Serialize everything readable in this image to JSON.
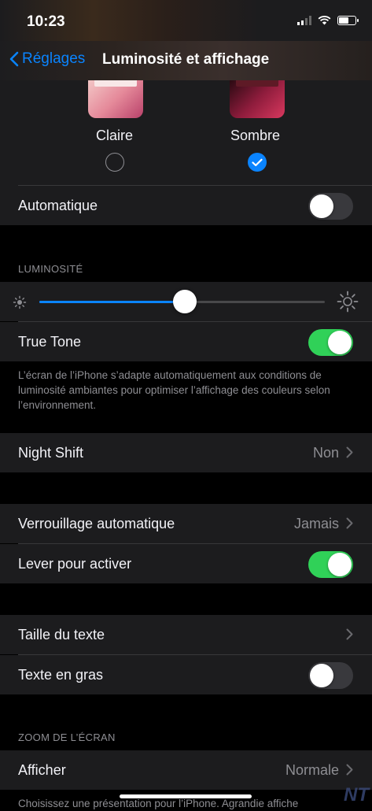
{
  "status_bar": {
    "time": "10:23"
  },
  "nav": {
    "back_label": "Réglages",
    "title": "Luminosité et affichage"
  },
  "appearance": {
    "light_label": "Claire",
    "dark_label": "Sombre",
    "selected": "Sombre",
    "automatic_label": "Automatique",
    "automatic_on": false
  },
  "brightness": {
    "header": "LUMINOSITÉ",
    "level": 0.51,
    "true_tone_label": "True Tone",
    "true_tone_on": true,
    "footer": "L’écran de l’iPhone s’adapte automatiquement aux conditions de luminosité ambiantes pour optimiser l’affichage des couleurs selon l’environnement."
  },
  "night_shift": {
    "label": "Night Shift",
    "value": "Non"
  },
  "lock": {
    "auto_lock_label": "Verrouillage automatique",
    "auto_lock_value": "Jamais",
    "raise_to_wake_label": "Lever pour activer",
    "raise_to_wake_on": true
  },
  "text": {
    "text_size_label": "Taille du texte",
    "bold_text_label": "Texte en gras",
    "bold_text_on": false
  },
  "zoom": {
    "header": "ZOOM DE L’ÉCRAN",
    "view_label": "Afficher",
    "view_value": "Normale",
    "footer": "Choisissez une présentation pour l’iPhone. Agrandie affiche"
  },
  "watermark": "NT",
  "colors": {
    "accent": "#0a84ff",
    "toggle_on": "#30d158",
    "cell_bg": "#1c1c1e",
    "bg": "#000000"
  }
}
